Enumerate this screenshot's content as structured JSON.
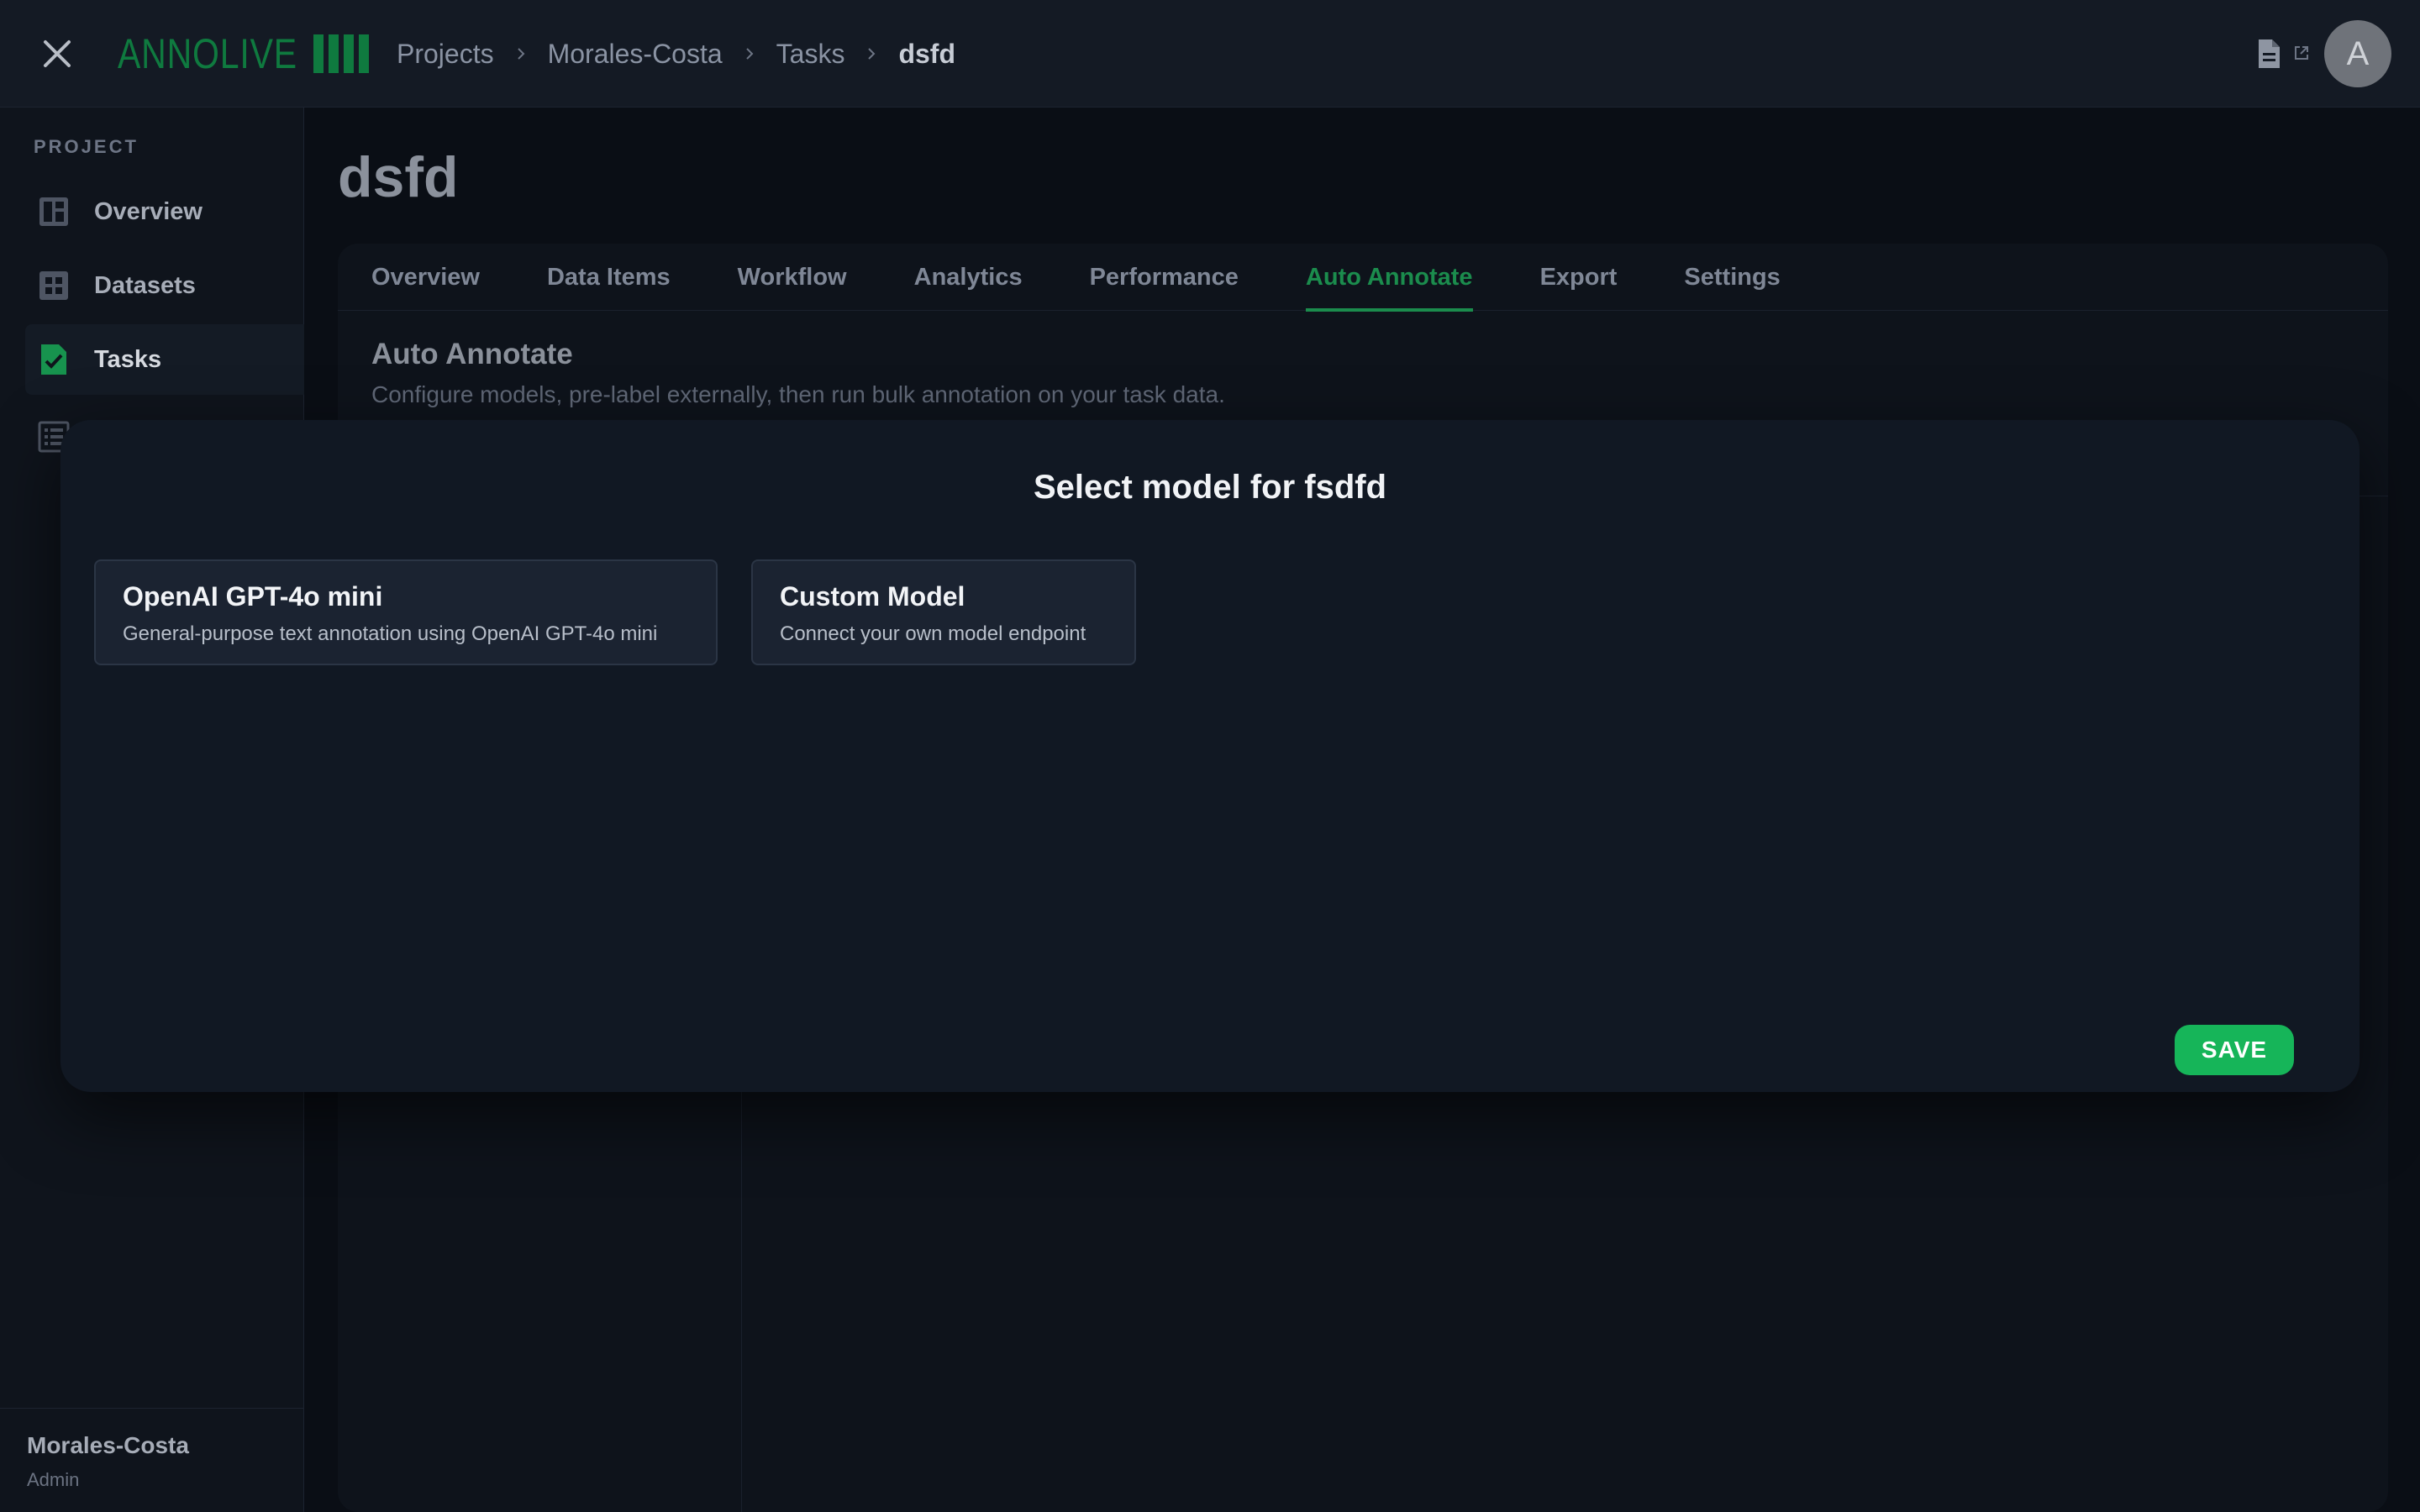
{
  "app": {
    "logo_text": "ANNOLIVE"
  },
  "breadcrumb": {
    "items": [
      "Projects",
      "Morales-Costa",
      "Tasks"
    ],
    "current": "dsfd"
  },
  "user": {
    "avatar_initial": "A"
  },
  "sidebar": {
    "section_label": "PROJECT",
    "items": [
      {
        "label": "Overview",
        "icon": "dashboard-icon"
      },
      {
        "label": "Datasets",
        "icon": "grid-icon"
      },
      {
        "label": "Tasks",
        "icon": "task-check-icon",
        "active": true
      },
      {
        "label": "",
        "icon": "list-icon"
      }
    ],
    "org": {
      "name": "Morales-Costa",
      "role": "Admin"
    }
  },
  "page": {
    "title": "dsfd",
    "tabs": [
      "Overview",
      "Data Items",
      "Workflow",
      "Analytics",
      "Performance",
      "Auto Annotate",
      "Export",
      "Settings"
    ],
    "active_tab": "Auto Annotate",
    "section_title": "Auto Annotate",
    "section_desc": "Configure models, pre-label externally, then run bulk annotation on your task data."
  },
  "modal": {
    "title": "Select model for fsdfd",
    "models": [
      {
        "name": "OpenAI GPT-4o mini",
        "desc": "General-purpose text annotation using OpenAI GPT-4o mini"
      },
      {
        "name": "Custom Model",
        "desc": "Connect your own model endpoint"
      }
    ],
    "save_label": "SAVE"
  },
  "colors": {
    "accent": "#16b559",
    "brand": "#0f7a3f",
    "active_tab": "#1b8c4d"
  }
}
